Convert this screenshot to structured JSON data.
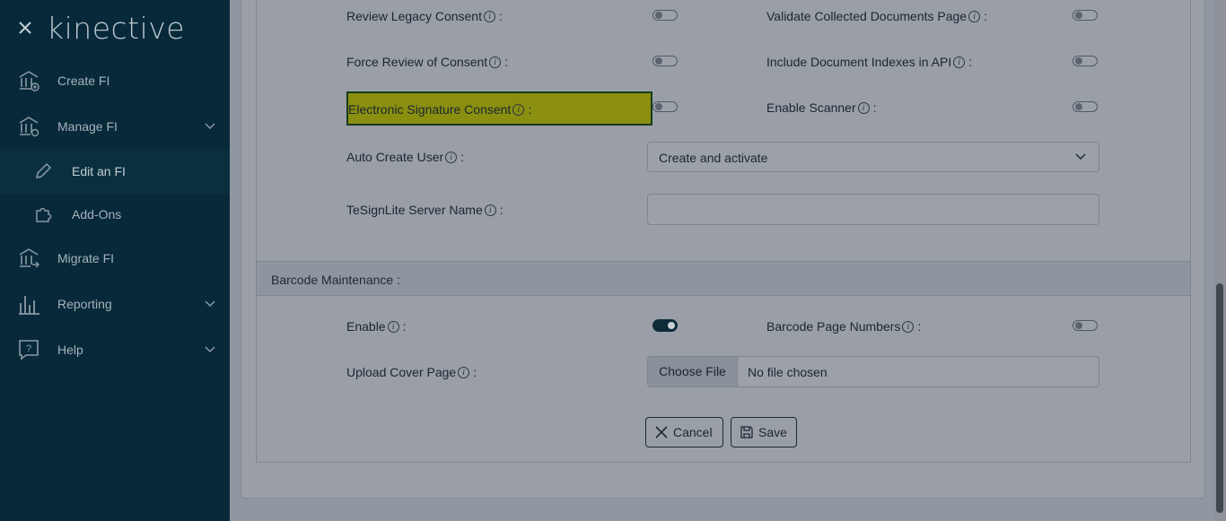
{
  "sidebar": {
    "brand": "kinective",
    "items": [
      {
        "label": "Create FI",
        "icon": "bank-add-icon"
      },
      {
        "label": "Manage FI",
        "icon": "bank-settings-icon"
      },
      {
        "label": "Edit an FI",
        "icon": "pencil-icon"
      },
      {
        "label": "Add-Ons",
        "icon": "puzzle-icon"
      },
      {
        "label": "Migrate FI",
        "icon": "bank-migrate-icon"
      },
      {
        "label": "Reporting",
        "icon": "bar-chart-icon"
      },
      {
        "label": "Help",
        "icon": "help-icon"
      }
    ]
  },
  "form": {
    "review_legacy_consent": {
      "label": "Review Legacy Consent",
      "enabled": false
    },
    "validate_collected_documents_page": {
      "label": "Validate Collected Documents Page",
      "enabled": false
    },
    "force_review_of_consent": {
      "label": "Force Review of Consent",
      "enabled": false
    },
    "include_document_indexes_in_api": {
      "label": "Include Document Indexes in API",
      "enabled": false
    },
    "electronic_signature_consent": {
      "label": "Electronic Signature Consent",
      "enabled": false
    },
    "enable_scanner": {
      "label": "Enable Scanner",
      "enabled": false
    },
    "auto_create_user": {
      "label": "Auto Create User",
      "value": "Create and activate"
    },
    "tesignlite_server_name": {
      "label": "TeSignLite Server Name",
      "value": ""
    },
    "colon": ":",
    "info": "i"
  },
  "barcode": {
    "section_title": "Barcode Maintenance :",
    "enable": {
      "label": "Enable",
      "enabled": true
    },
    "barcode_page_numbers": {
      "label": "Barcode Page Numbers",
      "enabled": false
    },
    "upload_cover_page": {
      "label": "Upload Cover Page",
      "button": "Choose File",
      "file_name": "No file chosen"
    }
  },
  "actions": {
    "cancel": "Cancel",
    "save": "Save"
  },
  "colors": {
    "sidebar_bg": "#07293a",
    "highlight": "#8a8f10",
    "overlay_bg": "#9197a0"
  }
}
